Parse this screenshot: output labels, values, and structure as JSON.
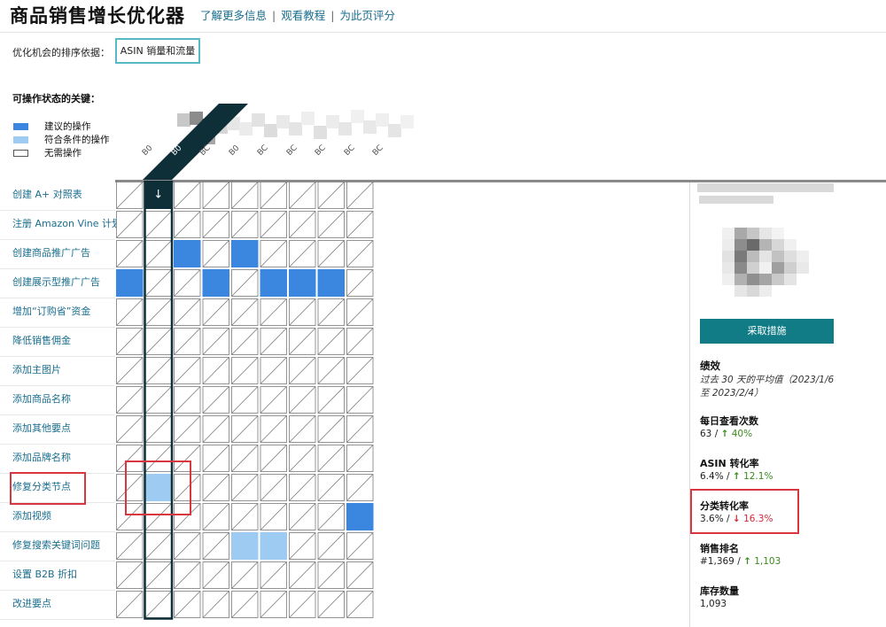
{
  "header": {
    "title": "商品销售增长优化器",
    "links": [
      "了解更多信息",
      "观看教程",
      "为此页评分"
    ],
    "separator": "|"
  },
  "sort": {
    "label": "优化机会的排序依据：",
    "value": "ASIN 销量和流量"
  },
  "key": {
    "title": "可操作状态的关键：",
    "items": [
      {
        "label": "建议的操作",
        "color": "#3b87e0"
      },
      {
        "label": "符合条件的操作",
        "color": "#9ecbf2"
      },
      {
        "label": "无需操作",
        "color": "#ffffff"
      }
    ]
  },
  "colors": {
    "recommended": "#3b87e0",
    "eligible": "#9ecbf2",
    "highlight_column": "#0e2f38",
    "accent": "#117c86",
    "link": "#1a6e8e",
    "up": "#3a8a1c",
    "down": "#d2283a",
    "annotation_box": "#d9373f"
  },
  "columns": [
    "B0",
    "B0",
    "BC",
    "B0",
    "BC",
    "BC",
    "BC",
    "BC",
    "BC"
  ],
  "highlight_column_label": "B0",
  "highlight_column_icon": "arrow-down-icon",
  "rows": [
    {
      "label": "创建 A+ 对照表",
      "cells": [
        0,
        "h",
        0,
        0,
        0,
        0,
        0,
        0,
        0
      ]
    },
    {
      "label": "注册 Amazon Vine 计划",
      "cells": [
        0,
        0,
        0,
        0,
        0,
        0,
        0,
        0,
        0
      ]
    },
    {
      "label": "创建商品推广广告",
      "cells": [
        0,
        0,
        2,
        0,
        2,
        0,
        0,
        0,
        0
      ]
    },
    {
      "label": "创建展示型推广广告",
      "cells": [
        2,
        0,
        0,
        2,
        0,
        2,
        2,
        2,
        0
      ]
    },
    {
      "label": "增加“订购省”资金",
      "cells": [
        0,
        0,
        0,
        0,
        0,
        0,
        0,
        0,
        0
      ]
    },
    {
      "label": "降低销售佣金",
      "cells": [
        0,
        0,
        0,
        0,
        0,
        0,
        0,
        0,
        0
      ]
    },
    {
      "label": "添加主图片",
      "cells": [
        0,
        0,
        0,
        0,
        0,
        0,
        0,
        0,
        0
      ]
    },
    {
      "label": "添加商品名称",
      "cells": [
        0,
        0,
        0,
        0,
        0,
        0,
        0,
        0,
        0
      ]
    },
    {
      "label": "添加其他要点",
      "cells": [
        0,
        0,
        0,
        0,
        0,
        0,
        0,
        0,
        0
      ]
    },
    {
      "label": "添加品牌名称",
      "cells": [
        0,
        0,
        0,
        0,
        0,
        0,
        0,
        0,
        0
      ]
    },
    {
      "label": "修复分类节点",
      "cells": [
        0,
        1,
        0,
        0,
        0,
        0,
        0,
        0,
        0
      ]
    },
    {
      "label": "添加视频",
      "cells": [
        0,
        0,
        0,
        0,
        0,
        0,
        0,
        0,
        2
      ]
    },
    {
      "label": "修复搜索关键词问题",
      "cells": [
        0,
        0,
        0,
        0,
        1,
        1,
        0,
        0,
        0
      ]
    },
    {
      "label": "设置 B2B 折扣",
      "cells": [
        0,
        0,
        0,
        0,
        0,
        0,
        0,
        0,
        0
      ]
    },
    {
      "label": "改进要点",
      "cells": [
        0,
        0,
        0,
        0,
        0,
        0,
        0,
        0,
        0
      ]
    }
  ],
  "panel": {
    "action_button": "采取措施",
    "performance_title": "绩效",
    "performance_sub_1": "过去 30 天的平均值（2023/1/6",
    "performance_sub_2": "至 2023/2/4）",
    "metrics": [
      {
        "title": "每日查看次数",
        "value": "63 /",
        "direction": "up",
        "change": "40%"
      },
      {
        "title": "ASIN 转化率",
        "value": "6.4% /",
        "direction": "up",
        "change": "12.1%"
      },
      {
        "title": "分类转化率",
        "value": "3.6% /",
        "direction": "down",
        "change": "16.3%"
      },
      {
        "title": "销售排名",
        "value": "#1,369 /",
        "direction": "up",
        "change": "1,103"
      },
      {
        "title": "库存数量",
        "value": "1,093",
        "direction": "",
        "change": ""
      }
    ]
  }
}
